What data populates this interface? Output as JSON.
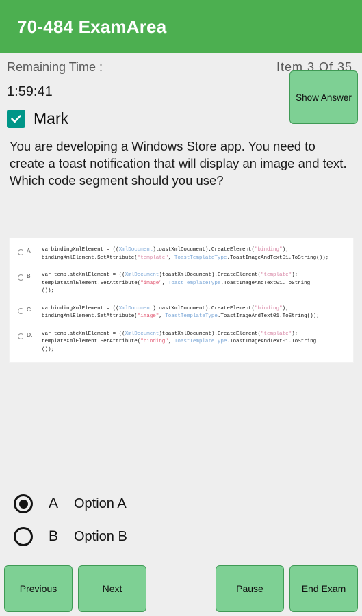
{
  "app": {
    "title": "70-484 ExamArea",
    "header_color": "#4caf50",
    "button_color": "#7ed094",
    "checkbox_color": "#009688",
    "background_color": "#eeeeee"
  },
  "status": {
    "remaining_time_label": "Remaining Time :",
    "timer_value": "1:59:41",
    "item_counter": "Item 3 Of 35",
    "show_answer_label": "Show Answer",
    "mark_label": "Mark",
    "mark_checked": true,
    "check_icon": "check-icon"
  },
  "question": {
    "text": "You are developing a Windows Store app. You need to create a toast notification that will display an image and text. Which code segment should you use?"
  },
  "code_options": [
    {
      "letter": "A",
      "selected": false,
      "lines": [
        [
          {
            "t": "varbindingXmlElement = ((",
            "c": "plain"
          },
          {
            "t": "XmlDocument",
            "c": "type"
          },
          {
            "t": ")toastXmlDocument).CreateElement(",
            "c": "plain"
          },
          {
            "t": "\"binding\"",
            "c": "str"
          },
          {
            "t": ");",
            "c": "plain"
          }
        ],
        [
          {
            "t": "bindingXmlElement.SetAttribute(",
            "c": "plain"
          },
          {
            "t": "\"template\"",
            "c": "str"
          },
          {
            "t": ", ",
            "c": "plain"
          },
          {
            "t": "ToastTemplateType",
            "c": "type"
          },
          {
            "t": ".ToastImageAndText01.ToString());",
            "c": "plain"
          }
        ]
      ]
    },
    {
      "letter": "B",
      "selected": false,
      "lines": [
        [
          {
            "t": "var templateXmlElement = ((",
            "c": "plain"
          },
          {
            "t": "XmlDocument",
            "c": "type"
          },
          {
            "t": ")toastXmlDocument).CreateElement(",
            "c": "plain"
          },
          {
            "t": "\"template\"",
            "c": "str"
          },
          {
            "t": ");",
            "c": "plain"
          }
        ],
        [
          {
            "t": "templateXmlElement.SetAttribute(",
            "c": "plain"
          },
          {
            "t": "\"image\"",
            "c": "str2"
          },
          {
            "t": ", ",
            "c": "plain"
          },
          {
            "t": "ToastTemplateType",
            "c": "type"
          },
          {
            "t": ".ToastImageAndText01.ToString",
            "c": "plain"
          }
        ],
        [
          {
            "t": "());",
            "c": "plain"
          }
        ]
      ]
    },
    {
      "letter": "C.",
      "selected": false,
      "lines": [
        [
          {
            "t": "varbindingXmlElement = ((",
            "c": "plain"
          },
          {
            "t": "XmlDocument",
            "c": "type"
          },
          {
            "t": ")toastXmlDocument).CreateElement(",
            "c": "plain"
          },
          {
            "t": "\"binding\"",
            "c": "str"
          },
          {
            "t": ");",
            "c": "plain"
          }
        ],
        [
          {
            "t": "bindingXmlElement.SetAttribute(",
            "c": "plain"
          },
          {
            "t": "\"image\"",
            "c": "str2"
          },
          {
            "t": ", ",
            "c": "plain"
          },
          {
            "t": "ToastTemplateType",
            "c": "type"
          },
          {
            "t": ".ToastImageAndText01.ToString());",
            "c": "plain"
          }
        ]
      ]
    },
    {
      "letter": "D.",
      "selected": false,
      "lines": [
        [
          {
            "t": "var templateXmlElement = ((",
            "c": "plain"
          },
          {
            "t": "XmlDocument",
            "c": "type"
          },
          {
            "t": ")toastXmlDocument).CreateElement(",
            "c": "plain"
          },
          {
            "t": "\"template\"",
            "c": "str"
          },
          {
            "t": ");",
            "c": "plain"
          }
        ],
        [
          {
            "t": "templateXmlElement.SetAttribute(",
            "c": "plain"
          },
          {
            "t": "\"binding\"",
            "c": "str2"
          },
          {
            "t": ", ",
            "c": "plain"
          },
          {
            "t": "ToastTemplateType",
            "c": "type"
          },
          {
            "t": ".ToastImageAndText01.ToString",
            "c": "plain"
          }
        ],
        [
          {
            "t": "());",
            "c": "plain"
          }
        ]
      ]
    }
  ],
  "answers": [
    {
      "letter": "A",
      "label": "Option A",
      "selected": true
    },
    {
      "letter": "B",
      "label": "Option B",
      "selected": false
    }
  ],
  "bottom_bar": {
    "previous_label": "Previous",
    "next_label": "Next",
    "pause_label": "Pause",
    "end_exam_label": "End Exam"
  }
}
